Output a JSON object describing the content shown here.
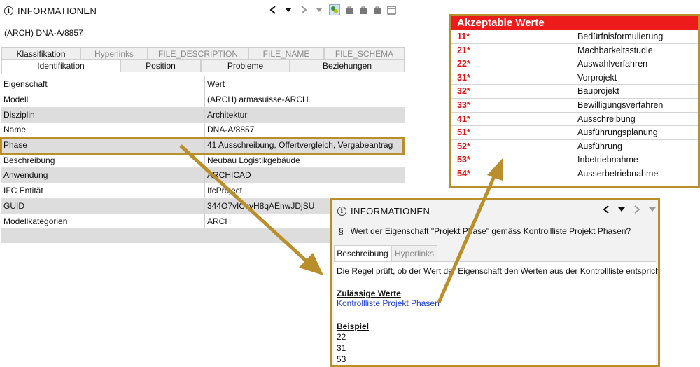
{
  "main_panel": {
    "title": "INFORMATIONEN",
    "subtitle": "(ARCH) DNA-A/8857",
    "tabs_row1": [
      "Klassifikation",
      "Hyperlinks",
      "FILE_DESCRIPTION",
      "FILE_NAME",
      "FILE_SCHEMA"
    ],
    "tabs_row2": [
      "Identifikation",
      "Position",
      "Probleme",
      "Beziehungen"
    ],
    "table": {
      "headers": [
        "Eigenschaft",
        "Wert"
      ],
      "rows": [
        [
          "Modell",
          "(ARCH) armasuisse-ARCH"
        ],
        [
          "Disziplin",
          "Architektur"
        ],
        [
          "Name",
          "DNA-A/8857"
        ],
        [
          "Phase",
          "41 Ausschreibung, Offertvergleich, Vergabeantrag"
        ],
        [
          "Beschreibung",
          "Neubau Logistikgebäude"
        ],
        [
          "Anwendung",
          "ARCHICAD"
        ],
        [
          "IFC Entität",
          "IfcProject"
        ],
        [
          "GUID",
          "344O7vICcvH8qAEnwJDjSU"
        ],
        [
          "Modellkategorien",
          "ARCH"
        ]
      ]
    }
  },
  "accepted_values": {
    "title": "Akzeptable Werte",
    "rows": [
      [
        "11*",
        "Bedürfnisformulierung"
      ],
      [
        "21*",
        "Machbarkeitsstudie"
      ],
      [
        "22*",
        "Auswahlverfahren"
      ],
      [
        "31*",
        "Vorprojekt"
      ],
      [
        "32*",
        "Bauprojekt"
      ],
      [
        "33*",
        "Bewilligungsverfahren"
      ],
      [
        "41*",
        "Ausschreibung"
      ],
      [
        "51*",
        "Ausführungsplanung"
      ],
      [
        "52*",
        "Ausführung"
      ],
      [
        "53*",
        "Inbetriebnahme"
      ],
      [
        "54*",
        "Ausserbetriebnahme"
      ]
    ]
  },
  "info_popup": {
    "title": "INFORMATIONEN",
    "section_symbol": "§",
    "question": "Wert der Eigenschaft \"Projekt Phase\" gemäss Kontrollliste Projekt Phasen?",
    "tabs": [
      "Beschreibung",
      "Hyperlinks"
    ],
    "description": "Die Regel prüft, ob der Wert der Eigenschaft den Werten aus der Kontrollliste entspricht.",
    "allowed_heading": "Zulässige Werte",
    "allowed_link": "Kontrollliste Projekt Phasen",
    "example_heading": "Beispiel",
    "examples": [
      "22",
      "31",
      "53"
    ]
  },
  "colors": {
    "highlight": "#b98f2c",
    "accepted_header": "#ee1b1b",
    "code_text": "#e01010",
    "link": "#1a3fd0"
  }
}
